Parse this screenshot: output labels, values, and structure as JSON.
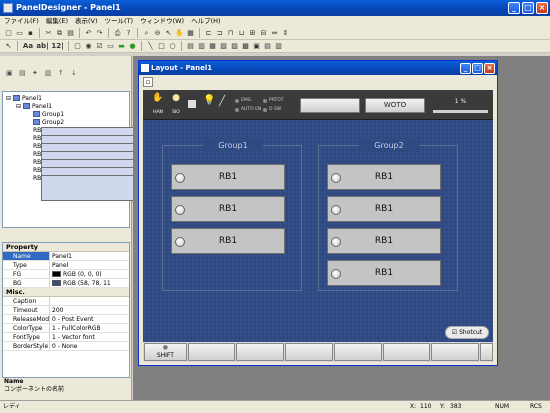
{
  "app": {
    "title": "PanelDesigner - Panel1"
  },
  "menu": [
    "ファイル(F)",
    "編集(E)",
    "表示(V)",
    "ツール(T)",
    "ウィンドウ(W)",
    "ヘルプ(H)"
  ],
  "toolbar2": {
    "font_label": "Aa",
    "ab_label": "ab|",
    "num_label": "12|"
  },
  "tree": {
    "root": "Panel1",
    "panel": "Panel1",
    "children": [
      "Group1",
      "Group2",
      "RB1",
      "RB2",
      "RB3",
      "RB4",
      "RB5",
      "RB6",
      "RB7"
    ]
  },
  "properties": {
    "header": "Property",
    "rows": [
      {
        "k": "Name",
        "v": "Panel1"
      },
      {
        "k": "Type",
        "v": "Panel"
      },
      {
        "k": "FG",
        "v": "RGB (0, 0, 0)",
        "color": "#000000"
      },
      {
        "k": "BG",
        "v": "RGB (58, 78, 11",
        "color": "#3a4e7a"
      }
    ],
    "misc_header": "Misc.",
    "misc_rows": [
      {
        "k": "Caption",
        "v": ""
      },
      {
        "k": "Timeout",
        "v": "200"
      },
      {
        "k": "ReleaseMode",
        "v": "0 - Post Event"
      },
      {
        "k": "ColorType",
        "v": "1 - FullColorRGB"
      },
      {
        "k": "FontType",
        "v": "1 - Vector font"
      },
      {
        "k": "BorderStyle",
        "v": "0 - None"
      }
    ]
  },
  "description": {
    "title": "Name",
    "text": "コンポーネントの名前"
  },
  "status": {
    "left": "レディ",
    "x_label": "X:",
    "x": "110",
    "y_label": "Y:",
    "y": "383",
    "num": "NUM",
    "scrl": "RCS"
  },
  "layout_window": {
    "title": "Layout - Panel1"
  },
  "strip": {
    "icons": [
      {
        "label": "HAN",
        "icon": "hand-icon"
      },
      {
        "label": "SIO",
        "icon": "bulb-icon"
      }
    ],
    "lamps": [
      "EMG",
      "AUTO EN",
      "PRTOT",
      "O SW"
    ],
    "btn_woto": "WOTO",
    "percent": "1 %"
  },
  "groups": [
    {
      "title": "Group1",
      "buttons": [
        "RB1",
        "RB1",
        "RB1"
      ]
    },
    {
      "title": "Group2",
      "buttons": [
        "RB1",
        "RB1",
        "RB1",
        "RB1"
      ]
    }
  ],
  "shotcut": "Shotcut",
  "bottom_keys": [
    "SHIFT",
    "",
    "",
    "",
    "",
    "",
    "",
    ""
  ]
}
